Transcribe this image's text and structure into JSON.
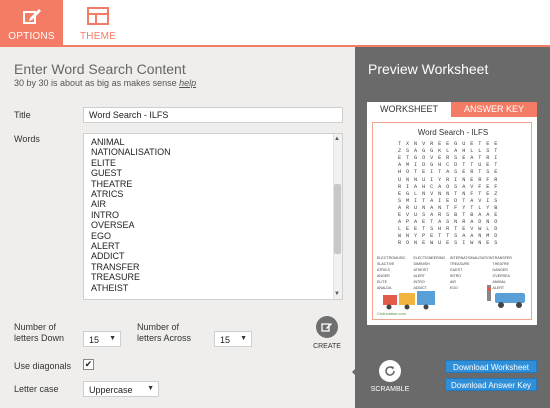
{
  "colors": {
    "accent": "#f47c66",
    "preview_bg": "#6a6a6a",
    "download": "#2f8fd8",
    "panel_bg": "#efeeec"
  },
  "tabs": [
    {
      "label": "OPTIONS",
      "icon": "edit-icon",
      "active": true
    },
    {
      "label": "THEME",
      "icon": "layout-icon",
      "active": false
    }
  ],
  "form": {
    "heading": "Enter Word Search Content",
    "subheading": "30 by 30 is about as big as makes sense",
    "help_link": "help",
    "title_label": "Title",
    "title_value": "Word Search - ILFS",
    "words_label": "Words",
    "words": [
      "ANIMAL",
      "NATIONALISATION",
      "ELITE",
      "GUEST",
      "THEATRE",
      "ATRICS",
      "AIR",
      "INTRO",
      "OVERSEA",
      "EGO",
      "ALERT",
      "ADDICT",
      "TRANSFER",
      "TREASURE",
      "ATHEIST"
    ],
    "down_label_1": "Number of",
    "down_label_2": "letters Down",
    "down_value": "15",
    "across_label_1": "Number of",
    "across_label_2": "letters Across",
    "across_value": "15",
    "create_label": "CREATE",
    "diagonals_label": "Use diagonals",
    "diagonals_checked": "✔",
    "lettercase_label": "Letter case",
    "lettercase_value": "Uppercase"
  },
  "preview": {
    "title": "Preview Worksheet",
    "tab_worksheet": "WORKSHEET",
    "tab_answer_key": "ANSWER KEY",
    "sheet_title": "Word Search - ILFS",
    "grid": [
      "T X N V R E E G U E T E E",
      "Z S A G G K L A H L L S T",
      "E T G O V E R S E A T R I",
      "A M I D G H C D T T U E T",
      "H O T E I T A S E R T S E",
      "U N N U I Y R I N E R F R",
      "R I A H C A O S A V F E F",
      "E G L N V N N T N F T E Z",
      "S M I T A I E D T A V I S",
      "A R U N A N T F Y T L Y B",
      "E V U S A R S B T B A A E",
      "A P A E T A S N R A D N O",
      "L E E T S H R T E V W L D",
      "W N Y P E T T S A A N M D",
      "R O N E W U E S I W N E S"
    ],
    "sheet_words": [
      "ELECTROMUSIC",
      "ELECTIONEERING",
      "INTERNATIONALISATION",
      "TRANSFER",
      "SLACTIVE",
      "DIMINISH",
      "TREASURE",
      "THEATRE",
      "ATRICS",
      "ATHEIST",
      "GUEST",
      "DANGER",
      "ANGER",
      "ALERT",
      "INTRO",
      "OVERSEA",
      "ELITE",
      "INTRO",
      "AIR",
      "ANIMAL",
      "ANALDA",
      "ADDICT",
      "EGO",
      "ALERT"
    ],
    "footer": "Ceducation.com",
    "scramble_label": "SCRAMBLE",
    "download_worksheet": "Download Worksheet",
    "download_answer_key": "Download Answer Key"
  }
}
